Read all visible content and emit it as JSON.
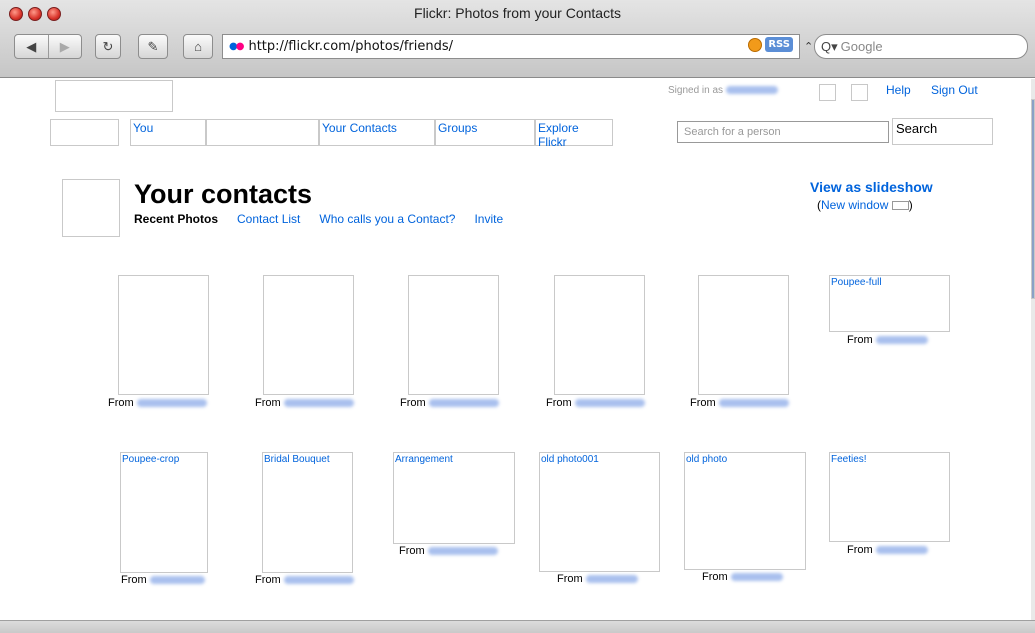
{
  "window": {
    "title": "Flickr: Photos from your Contacts"
  },
  "toolbar": {
    "back_icon": "back-arrow-icon",
    "forward_icon": "forward-arrow-icon",
    "reload_icon": "reload-icon",
    "edit_icon": "edit-icon",
    "home_icon": "home-icon",
    "url": "http://flickr.com/photos/friends/",
    "rss_label": "RSS",
    "search_placeholder": "Google"
  },
  "header": {
    "signed_in_label": "Signed in as",
    "help_label": "Help",
    "signout_label": "Sign Out",
    "nav": {
      "you": "You",
      "contacts": "Your Contacts",
      "groups": "Groups",
      "explore": "Explore Flickr"
    },
    "person_search_placeholder": "Search for a person",
    "search_button": "Search"
  },
  "main": {
    "title": "Your contacts",
    "tabs": {
      "recent": "Recent Photos",
      "list": "Contact List",
      "who": "Who calls you a Contact?",
      "invite": "Invite"
    },
    "slideshow_label": "View as slideshow",
    "new_window_open": "(",
    "new_window_label": "New window",
    "new_window_close": ")"
  },
  "photos": {
    "from_label": "From",
    "items": [
      {
        "title": ""
      },
      {
        "title": ""
      },
      {
        "title": ""
      },
      {
        "title": ""
      },
      {
        "title": ""
      },
      {
        "title": "Poupee-full"
      },
      {
        "title": "Poupee-crop"
      },
      {
        "title": "Bridal Bouquet"
      },
      {
        "title": "Arrangement"
      },
      {
        "title": "old photo001"
      },
      {
        "title": "old photo"
      },
      {
        "title": "Feeties!"
      }
    ]
  }
}
